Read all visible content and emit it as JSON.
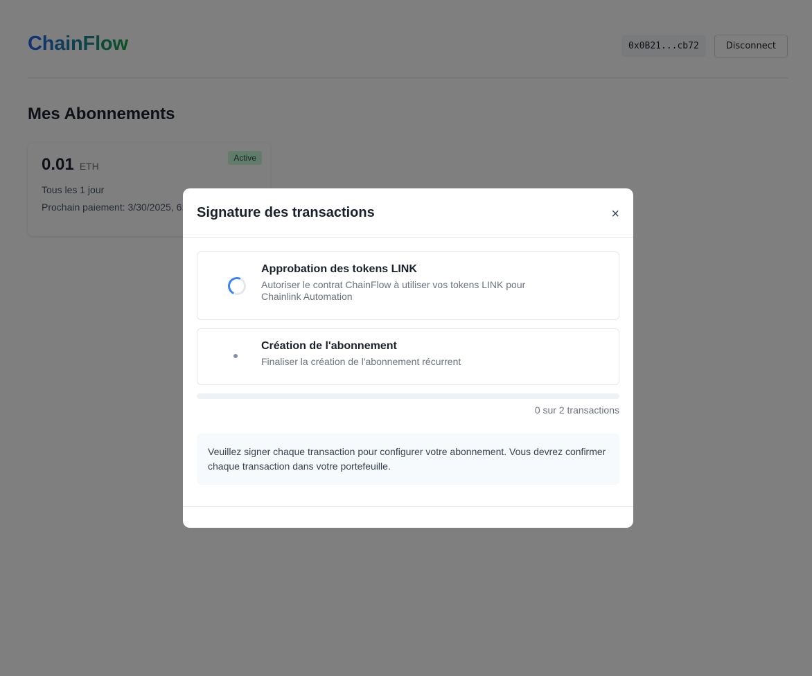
{
  "header": {
    "logo": "ChainFlow",
    "wallet_address": "0x0B21...cb72",
    "disconnect_label": "Disconnect"
  },
  "main": {
    "title": "Mes Abonnements",
    "subscription": {
      "amount": "0.01",
      "currency": "ETH",
      "status": "Active",
      "frequency": "Tous les 1 jour",
      "next_payment": "Prochain paiement: 3/30/2025, 6:"
    }
  },
  "modal": {
    "title": "Signature des transactions",
    "close_label": "×",
    "steps": [
      {
        "title": "Approbation des tokens LINK",
        "description": "Autoriser le contrat ChainFlow à utiliser vos tokens LINK pour Chainlink Automation",
        "state": "loading"
      },
      {
        "title": "Création de l'abonnement",
        "description": "Finaliser la création de l'abonnement récurrent",
        "state": "pending"
      }
    ],
    "progress": {
      "completed": 0,
      "total": 2,
      "label": "0 sur 2 transactions"
    },
    "info": "Veuillez signer chaque transaction pour configurer votre abonnement. Vous devrez confirmer chaque transaction dans votre portefeuille."
  },
  "colors": {
    "accent": "#3b82f6",
    "logo_start": "#2563eb",
    "logo_end": "#16a34a",
    "badge_bg": "#c6f6d5",
    "badge_text": "#22543d",
    "overlay": "rgba(0,0,0,0.5)"
  }
}
